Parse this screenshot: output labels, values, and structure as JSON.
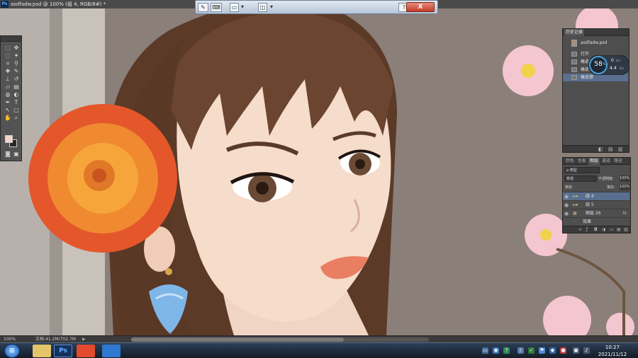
{
  "window": {
    "title": "asdfadw.psd @ 100% (组 4, RGB/8#) *",
    "app_badge": "Ps"
  },
  "options_bar": {
    "brush_glyph": "✎",
    "keyboard_glyph": "⌨",
    "tool_glyph": "▭",
    "mode_glyph": "◫",
    "chevron_glyph": "▾",
    "help_glyph": "?",
    "close_label": "X"
  },
  "tools": [
    {
      "name": "marquee-tool",
      "glyph": "⬚"
    },
    {
      "name": "move-tool",
      "glyph": "✥"
    },
    {
      "name": "lasso-tool",
      "glyph": "◌"
    },
    {
      "name": "magic-wand-tool",
      "glyph": "✦"
    },
    {
      "name": "crop-tool",
      "glyph": "⌗"
    },
    {
      "name": "eyedropper-tool",
      "glyph": "⚲"
    },
    {
      "name": "healing-tool",
      "glyph": "✚"
    },
    {
      "name": "brush-tool",
      "glyph": "✎"
    },
    {
      "name": "stamp-tool",
      "glyph": "⊥"
    },
    {
      "name": "history-brush-tool",
      "glyph": "↺"
    },
    {
      "name": "eraser-tool",
      "glyph": "▱"
    },
    {
      "name": "gradient-tool",
      "glyph": "▤"
    },
    {
      "name": "blur-tool",
      "glyph": "◍"
    },
    {
      "name": "dodge-tool",
      "glyph": "◐"
    },
    {
      "name": "pen-tool",
      "glyph": "✒"
    },
    {
      "name": "type-tool",
      "glyph": "T"
    },
    {
      "name": "path-select-tool",
      "glyph": "↖"
    },
    {
      "name": "shape-tool",
      "glyph": "▢"
    },
    {
      "name": "hand-tool",
      "glyph": "✋"
    },
    {
      "name": "zoom-tool",
      "glyph": "⌕"
    },
    {
      "name": "quick-mask-tool",
      "glyph": "◙"
    },
    {
      "name": "screen-mode-tool",
      "glyph": "▣"
    }
  ],
  "history": {
    "tab": "历史记录",
    "snapshot": "asdfadw.psd",
    "items": [
      "打开",
      "橡皮擦",
      "橡皮擦",
      "橡皮擦"
    ]
  },
  "gauge": {
    "value": "58",
    "unit": "%",
    "up": "0",
    "down": "4.4",
    "up_unit": "K/s",
    "down_unit": "K/s"
  },
  "layers": {
    "tabs": [
      "颜色",
      "色板",
      "图层",
      "通道",
      "路径"
    ],
    "kind": "ρ 类型",
    "blend": "穿透",
    "opacity_label": "不透明度:",
    "opacity": "100%",
    "lock_label": "锁定:",
    "fill_label": "填充:",
    "fill": "100%",
    "items": [
      {
        "name": "组 4",
        "type": "group"
      },
      {
        "name": "组 5",
        "type": "group"
      },
      {
        "name": "图层 26",
        "type": "layer",
        "fx": "fx"
      },
      {
        "name": "效果",
        "type": "effect"
      }
    ]
  },
  "status": {
    "zoom": "100%",
    "doc": "文档:41.2M/702.7M"
  },
  "taskbar": {
    "time": "10:27",
    "date": "2021/11/12",
    "ps_label": "Ps"
  }
}
